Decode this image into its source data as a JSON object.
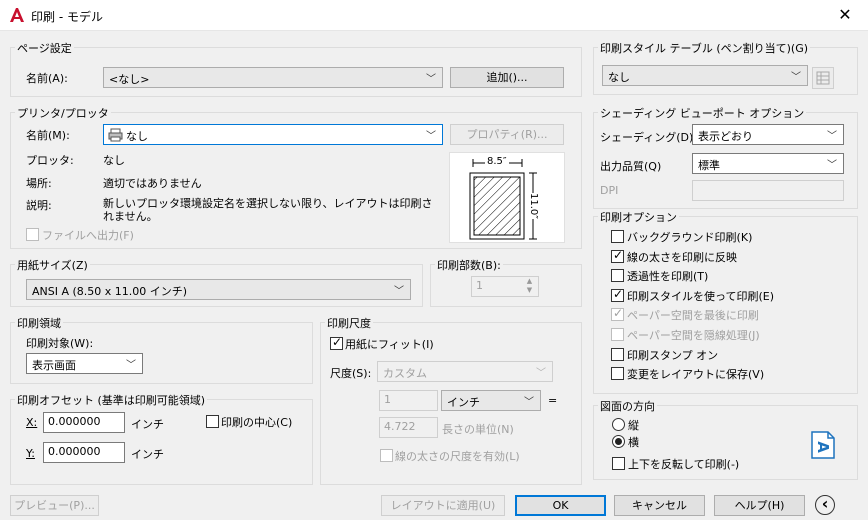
{
  "window": {
    "title": "印刷 - モデル",
    "close_glyph": "✕"
  },
  "page_setup": {
    "group_label": "ページ設定",
    "name_label": "名前(A):",
    "name_value": "<なし>",
    "add_button": "追加()..."
  },
  "printer": {
    "group_label": "プリンタ/プロッタ",
    "name_label": "名前(M):",
    "name_value": "なし",
    "properties_button": "プロパティ(R)...",
    "plotter_label": "プロッタ:",
    "plotter_value": "なし",
    "location_label": "場所:",
    "location_value": "適切ではありません",
    "description_label": "説明:",
    "description_value": "新しいプロッタ環境設定名を選択しない限り、レイアウトは印刷されません。",
    "plot_to_file": "ファイルへ出力(F)",
    "preview_width": "8.5″",
    "preview_height": "11.0″"
  },
  "paper_size": {
    "group_label": "用紙サイズ(Z)",
    "value": "ANSI A (8.50 x 11.00 インチ)"
  },
  "copies": {
    "group_label": "印刷部数(B):",
    "value": "1"
  },
  "plot_area": {
    "group_label": "印刷領域",
    "what_label": "印刷対象(W):",
    "what_value": "表示画面"
  },
  "plot_offset": {
    "group_label": "印刷オフセット (基準は印刷可能領域)",
    "x_label": "X:",
    "x_value": "0.000000",
    "x_unit": "インチ",
    "y_label": "Y:",
    "y_value": "0.000000",
    "y_unit": "インチ",
    "center": "印刷の中心(C)"
  },
  "plot_scale": {
    "group_label": "印刷尺度",
    "fit": "用紙にフィット(I)",
    "scale_label": "尺度(S):",
    "scale_value": "カスタム",
    "num_value": "1",
    "unit_value": "インチ",
    "equals": "=",
    "den_value": "4.722",
    "den_label": "長さの単位(N)",
    "lineweights": "線の太さの尺度を有効(L)"
  },
  "plot_style_table": {
    "group_label": "印刷スタイル テーブル (ペン割り当て)(G)",
    "value": "なし"
  },
  "shaded_viewport": {
    "group_label": "シェーディング ビューポート オプション",
    "shade_label": "シェーディング(D)",
    "shade_value": "表示どおり",
    "quality_label": "出力品質(Q)",
    "quality_value": "標準",
    "dpi_label": "DPI"
  },
  "plot_options": {
    "group_label": "印刷オプション",
    "items": [
      {
        "label": "バックグラウンド印刷(K)",
        "checked": false,
        "disabled": false
      },
      {
        "label": "線の太さを印刷に反映",
        "checked": true,
        "disabled": false
      },
      {
        "label": "透過性を印刷(T)",
        "checked": false,
        "disabled": false
      },
      {
        "label": "印刷スタイルを使って印刷(E)",
        "checked": true,
        "disabled": false
      },
      {
        "label": "ペーパー空間を最後に印刷",
        "checked": true,
        "disabled": true
      },
      {
        "label": "ペーパー空間を隠線処理(J)",
        "checked": false,
        "disabled": true
      },
      {
        "label": "印刷スタンプ オン",
        "checked": false,
        "disabled": false
      },
      {
        "label": "変更をレイアウトに保存(V)",
        "checked": false,
        "disabled": false
      }
    ]
  },
  "orientation": {
    "group_label": "図面の方向",
    "portrait": "縦",
    "landscape": "横",
    "upside_down": "上下を反転して印刷(-)",
    "orient_glyph": "A"
  },
  "footer": {
    "preview": "プレビュー(P)...",
    "apply": "レイアウトに適用(U)",
    "ok": "OK",
    "cancel": "キャンセル",
    "help": "ヘルプ(H)",
    "collapse_glyph": "‹"
  },
  "colors": {
    "accent": "#0078d7",
    "acad_red": "#c8102e",
    "orient_blue": "#1e73be"
  }
}
